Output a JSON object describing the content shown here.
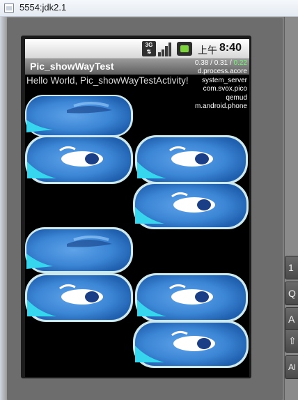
{
  "window": {
    "title": "5554:jdk2.1"
  },
  "status_bar": {
    "network_label": "3G",
    "ampm": "上午",
    "time": "8:40"
  },
  "app": {
    "title": "Pic_showWayTest",
    "hello_text": "Hello World, Pic_showWayTestActivity!"
  },
  "load_overlay": {
    "load_1": "0.38",
    "load_2": "0.31",
    "load_3": "0.22",
    "processes": [
      "d.process.acore",
      "system_server",
      "com.svox.pico",
      "qemud",
      "m.android.phone"
    ]
  },
  "keyboard": {
    "keys": [
      "1",
      "Q",
      "A",
      "⇧",
      "Al"
    ]
  },
  "images": [
    "fish-image",
    "fish-image",
    "fish-image",
    "fish-image",
    "fish-image",
    "fish-image",
    "fish-image",
    "fish-image"
  ],
  "colors": {
    "screen_bg": "#000000",
    "fish_blue": "#3c86d6",
    "fish_cyan": "#35d6ee",
    "battery_green": "#7ad43a",
    "load_accent": "#66ff66"
  }
}
